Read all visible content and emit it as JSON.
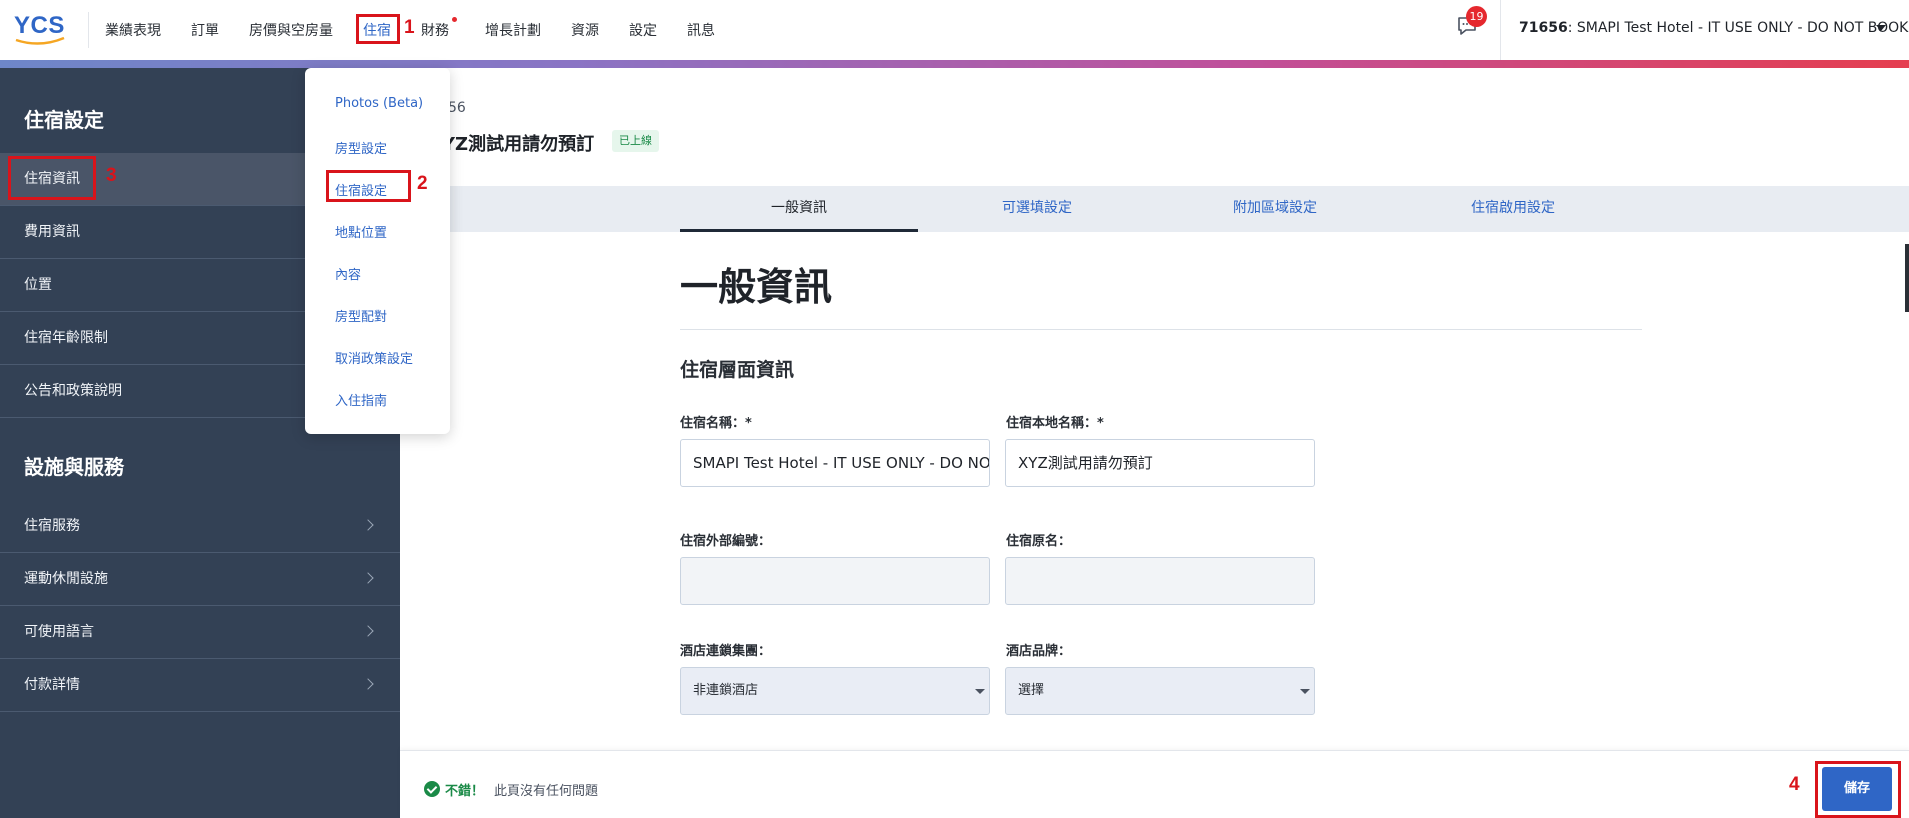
{
  "app": {
    "logo_text": "YCS"
  },
  "nav": {
    "items": [
      "業績表現",
      "訂單",
      "房價與空房量",
      "住宿",
      "財務",
      "增長計劃",
      "資源",
      "設定",
      "訊息"
    ],
    "active": "住宿"
  },
  "header": {
    "chat_badge": "19",
    "hotel_id": "71656",
    "hotel_name": ": SMAPI Test Hotel - IT USE ONLY - DO NOT BOOK"
  },
  "dropdown": {
    "items": [
      "Photos (Beta)",
      "房型設定",
      "住宿設定",
      "地點位置",
      "內容",
      "房型配對",
      "取消政策設定",
      "入住指南"
    ]
  },
  "sidebar": {
    "section1_title": "住宿設定",
    "section1_items": [
      "住宿資訊",
      "費用資訊",
      "位置",
      "住宿年齡限制",
      "公告和政策說明"
    ],
    "section2_title": "設施與服務",
    "section2_items": [
      "住宿服務",
      "運動休閒設施",
      "可使用語言",
      "付款詳情"
    ]
  },
  "content": {
    "property_id_partial": "56",
    "title_partial": "YZ測試用請勿預訂",
    "status": "已上線",
    "tabs": [
      "一般資訊",
      "可選填設定",
      "附加區域設定",
      "住宿啟用設定"
    ],
    "section_title": "一般資訊",
    "subsection_title": "住宿層面資訊",
    "fields": {
      "name_label": "住宿名稱：*",
      "name_value": "SMAPI Test Hotel - IT USE ONLY - DO NOT BOOK",
      "local_name_label": "住宿本地名稱：*",
      "local_name_value": "XYZ測試用請勿預訂",
      "external_id_label": "住宿外部編號：",
      "external_id_value": "",
      "original_name_label": "住宿原名：",
      "original_name_value": "",
      "chain_label": "酒店連鎖集團：",
      "chain_value": "非連鎖酒店",
      "brand_label": "酒店品牌：",
      "brand_value": "選擇"
    }
  },
  "footer": {
    "good": "不錯！",
    "message": "此頁沒有任何問題",
    "save_label": "儲存"
  },
  "annotations": [
    "1",
    "2",
    "3",
    "4"
  ],
  "colors": {
    "accent_blue": "#2f66c6",
    "sidebar_bg": "#334155",
    "highlight_red": "#d9141b",
    "status_green": "#1a8a47"
  }
}
